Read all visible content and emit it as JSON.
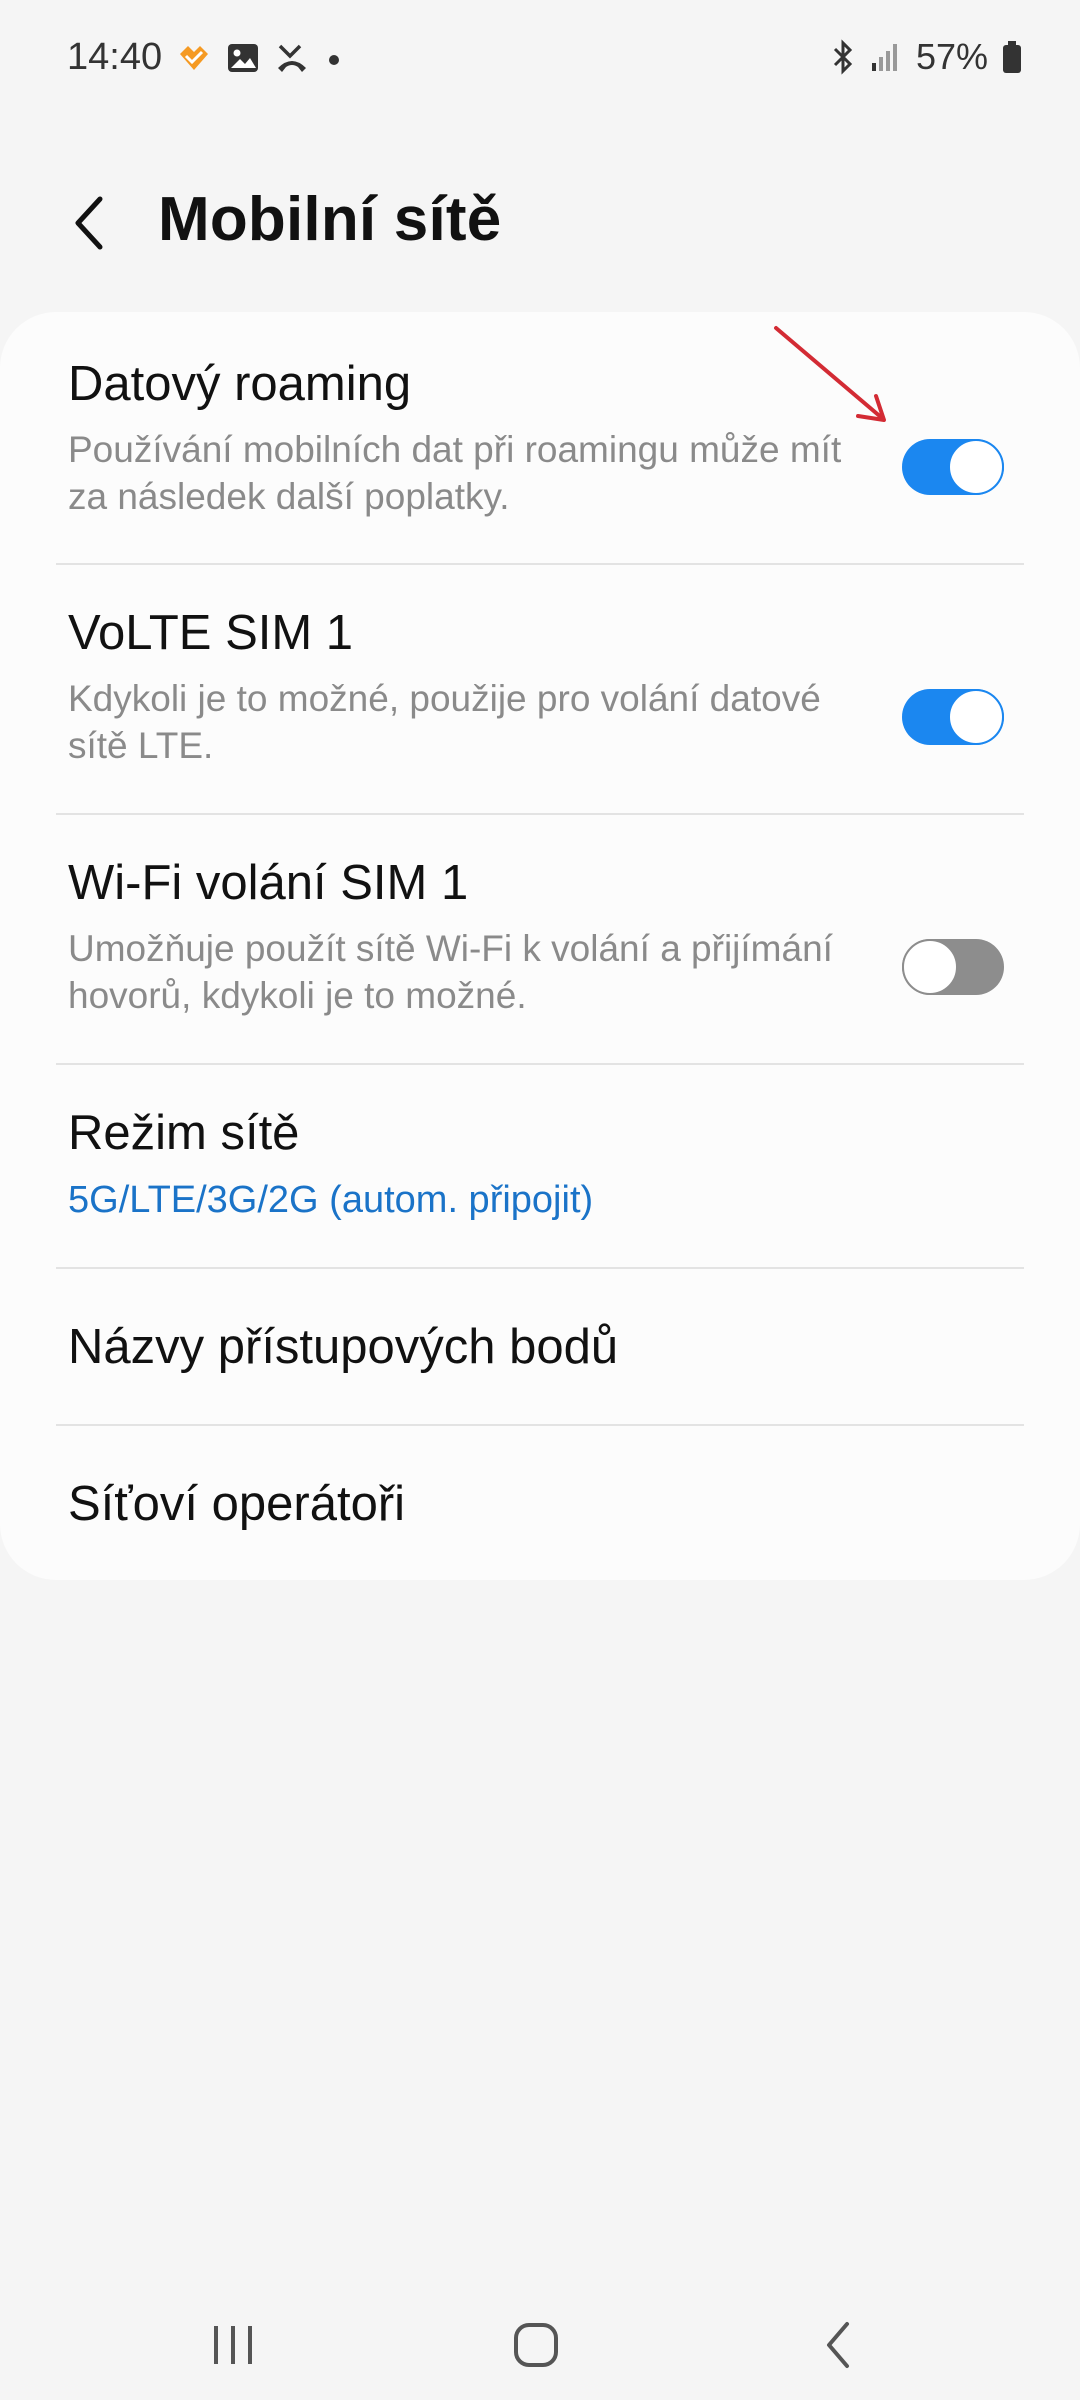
{
  "status_bar": {
    "time": "14:40",
    "battery": "57%",
    "left_icons": [
      "heart-app-icon",
      "gallery-icon",
      "missed-call-icon",
      "dot-icon"
    ],
    "right_icons": [
      "bluetooth-icon",
      "signal-icon",
      "battery-icon"
    ]
  },
  "header": {
    "title": "Mobilní sítě",
    "back_icon": "chevron-left-icon"
  },
  "settings": {
    "data_roaming": {
      "title": "Datový roaming",
      "description": "Používání mobilních dat při roamingu může mít za následek další poplatky.",
      "enabled": true
    },
    "volte": {
      "title": "VoLTE SIM 1",
      "description": "Kdykoli je to možné, použije pro volání datové sítě LTE.",
      "enabled": true
    },
    "wifi_calling": {
      "title": "Wi-Fi volání SIM 1",
      "description": "Umožňuje použít sítě Wi-Fi k volání a přijímání hovorů, kdykoli je to možné.",
      "enabled": false
    },
    "network_mode": {
      "title": "Režim sítě",
      "value": "5G/LTE/3G/2G (autom. připojit)"
    },
    "apn": {
      "title": "Názvy přístupových bodů"
    },
    "operators": {
      "title": "Síťoví operátoři"
    }
  },
  "colors": {
    "accent": "#1b87f0",
    "link": "#1a73c8",
    "toggle_off": "#8d8d8d",
    "annotation": "#d32b34",
    "background": "#f5f5f5",
    "card": "#fcfcfc"
  },
  "nav_bar": {
    "buttons": [
      "recent-apps-icon",
      "home-icon",
      "back-icon"
    ]
  }
}
